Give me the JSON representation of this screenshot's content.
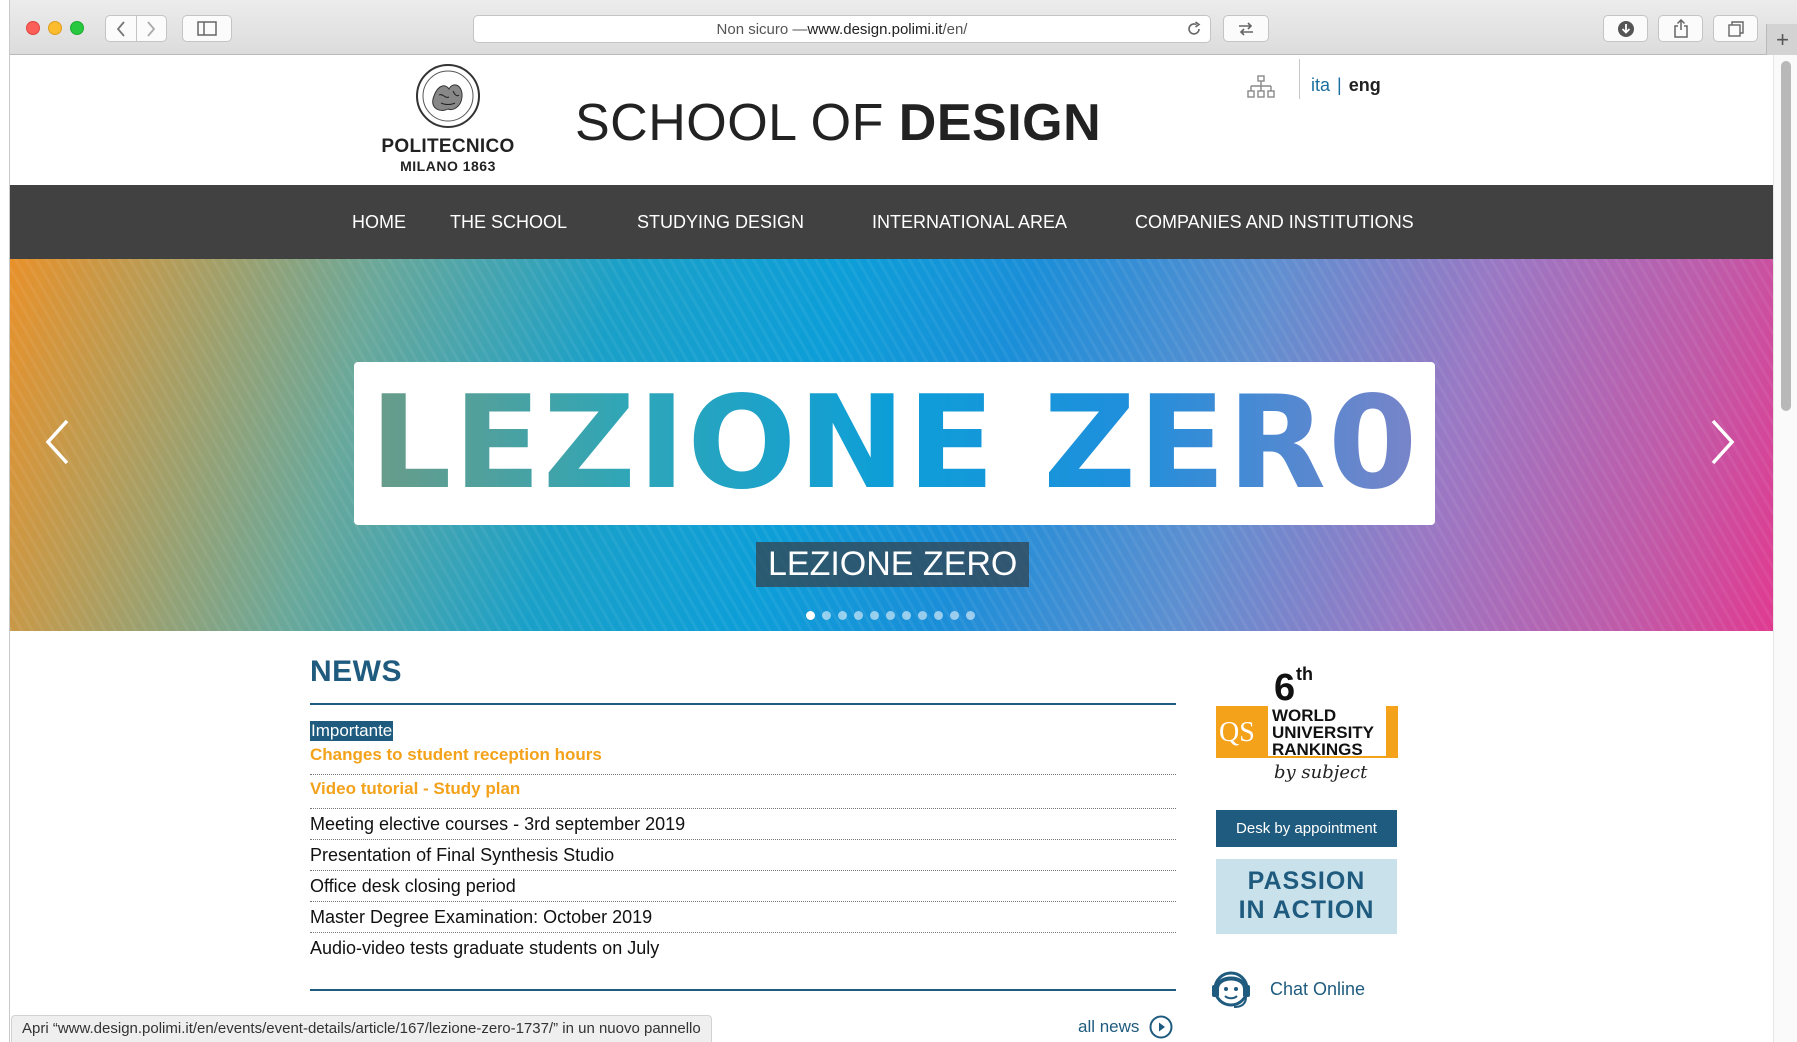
{
  "browser": {
    "address_prefix": "Non sicuro — ",
    "address_host": "www.design.polimi.it",
    "address_path": "/en/",
    "newtab_label": "+"
  },
  "header": {
    "logo_name": "POLITECNICO",
    "logo_year": "MILANO 1863",
    "title_light": "SCHOOL OF ",
    "title_bold": "DESIGN",
    "lang_ita": "ita",
    "lang_sep": "|",
    "lang_eng": "eng"
  },
  "nav": {
    "items": [
      "HOME",
      "THE SCHOOL",
      "STUDYING DESIGN",
      "INTERNATIONAL AREA",
      "COMPANIES AND INSTITUTIONS"
    ]
  },
  "hero": {
    "banner_text": "LEZIONE ZER0",
    "caption": "LEZIONE ZERO",
    "slide_count": 11,
    "active_slide": 1
  },
  "news": {
    "title": "NEWS",
    "featured": [
      {
        "tag": "Importante",
        "title": "Changes to student reception hours"
      },
      {
        "tag": "",
        "title": "Video tutorial - Study plan"
      }
    ],
    "items": [
      "Meeting elective courses - 3rd september 2019",
      "Presentation of Final Synthesis Studio",
      "Office desk closing period",
      "Master Degree Examination: October 2019",
      "Audio-video tests graduate students on July"
    ],
    "all_news": "all news"
  },
  "sidebar": {
    "rank_number": "6",
    "rank_suffix": "th",
    "rank_qs": "QS",
    "rank_line1": "WORLD",
    "rank_line2": "UNIVERSITY",
    "rank_line3": "RANKINGS",
    "rank_line4": "by subject",
    "desk_label": "Desk by appointment",
    "passion_line1": "PASSION",
    "passion_line2": "IN ACTION",
    "chat_label": "Chat Online"
  },
  "status": {
    "text": "Apri “www.design.polimi.it/en/events/event-details/article/167/lezione-zero-1737/” in un nuovo pannello"
  },
  "colors": {
    "brand_blue": "#1f5b7e",
    "accent_orange": "#f3a21a",
    "nav_bg": "#414141"
  }
}
